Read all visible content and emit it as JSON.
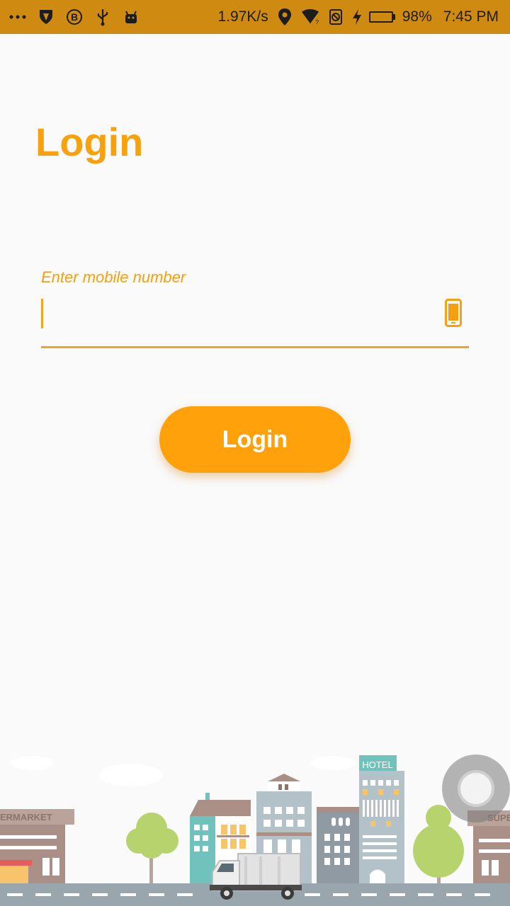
{
  "status_bar": {
    "net_speed": "1.97K/s",
    "battery_percent": "98%",
    "battery_level": 0.98,
    "time": "7:45 PM",
    "left_icons": [
      "more-dots-icon",
      "shield-icon",
      "bitcoin-icon",
      "usb-icon",
      "android-icon"
    ],
    "right_icons": [
      "location-icon",
      "wifi-icon",
      "no-sim-icon",
      "charging-icon",
      "battery-icon"
    ]
  },
  "page": {
    "title": "Login"
  },
  "mobile_field": {
    "label": "Enter mobile number",
    "value": "",
    "icon": "phone-icon"
  },
  "actions": {
    "login_label": "Login"
  },
  "illustration": {
    "signs": {
      "supermarket": "ERMARKET",
      "hotel": "HOTEL",
      "super_right": "SUPE"
    }
  },
  "colors": {
    "accent": "#fea10a",
    "status_bar": "#cf8a12",
    "background": "#fafafa"
  }
}
